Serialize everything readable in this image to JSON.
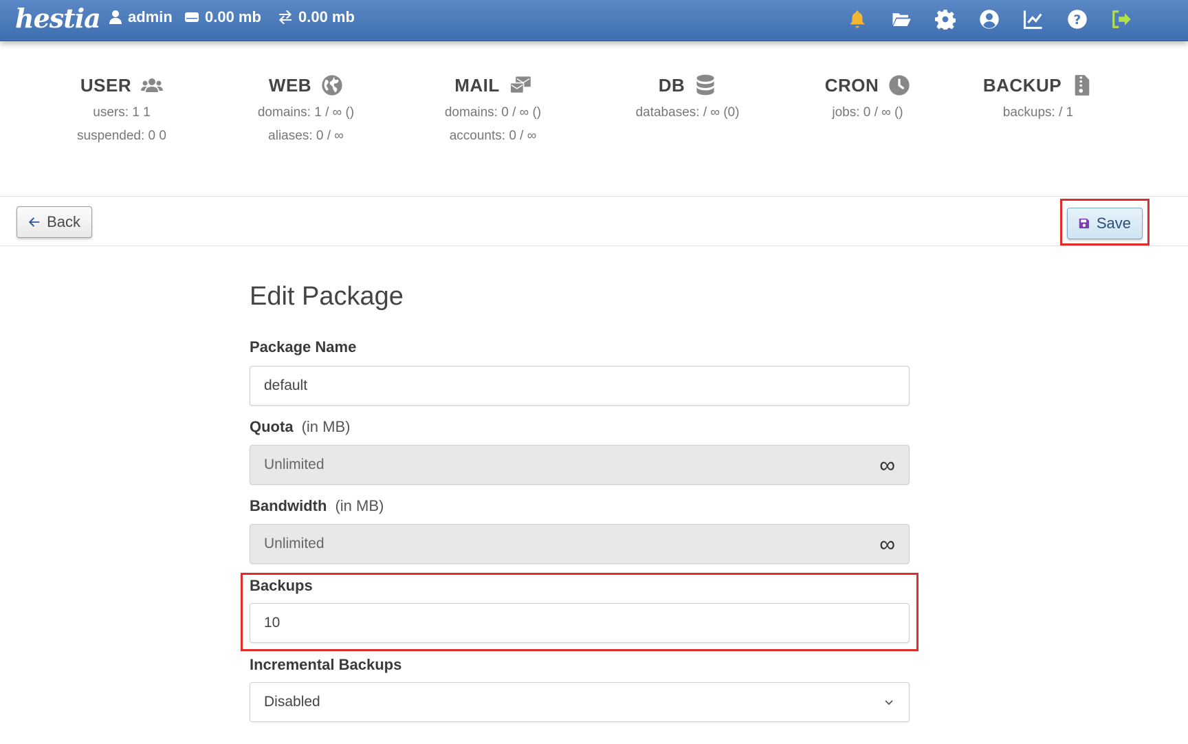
{
  "topbar": {
    "logo": "hestia",
    "user": "admin",
    "disk": "0.00 mb",
    "bandwidth": "0.00 mb",
    "icons": [
      "bell-icon",
      "folder-icon",
      "gear-icon",
      "user-circle-icon",
      "chart-icon",
      "help-icon",
      "logout-icon"
    ],
    "bell_color": "#f2b731",
    "logout_color": "#b4e04c"
  },
  "summary": {
    "user": {
      "title": "USER",
      "line1": "users: 1 1",
      "line2": "suspended: 0 0"
    },
    "web": {
      "title": "WEB",
      "line1": "domains: 1 / ∞ ()",
      "line2": "aliases: 0 / ∞"
    },
    "mail": {
      "title": "MAIL",
      "line1": "domains: 0 / ∞ ()",
      "line2": "accounts: 0 / ∞"
    },
    "db": {
      "title": "DB",
      "line1": "databases: / ∞ (0)"
    },
    "cron": {
      "title": "CRON",
      "line1": "jobs: 0 / ∞ ()"
    },
    "backup": {
      "title": "BACKUP",
      "line1": "backups: / 1"
    }
  },
  "toolbar": {
    "back_label": "Back",
    "save_label": "Save"
  },
  "form": {
    "title": "Edit Package",
    "package_name": {
      "label": "Package Name",
      "value": "default"
    },
    "quota": {
      "label": "Quota",
      "hint": "(in MB)",
      "value": "Unlimited",
      "symbol": "∞"
    },
    "bandwidth": {
      "label": "Bandwidth",
      "hint": "(in MB)",
      "value": "Unlimited",
      "symbol": "∞"
    },
    "backups": {
      "label": "Backups",
      "value": "10"
    },
    "incremental": {
      "label": "Incremental Backups",
      "value": "Disabled"
    }
  },
  "colors": {
    "topbar": "#4a7abb",
    "highlight": "#e02b2b",
    "save_icon": "#7b3fb0"
  }
}
